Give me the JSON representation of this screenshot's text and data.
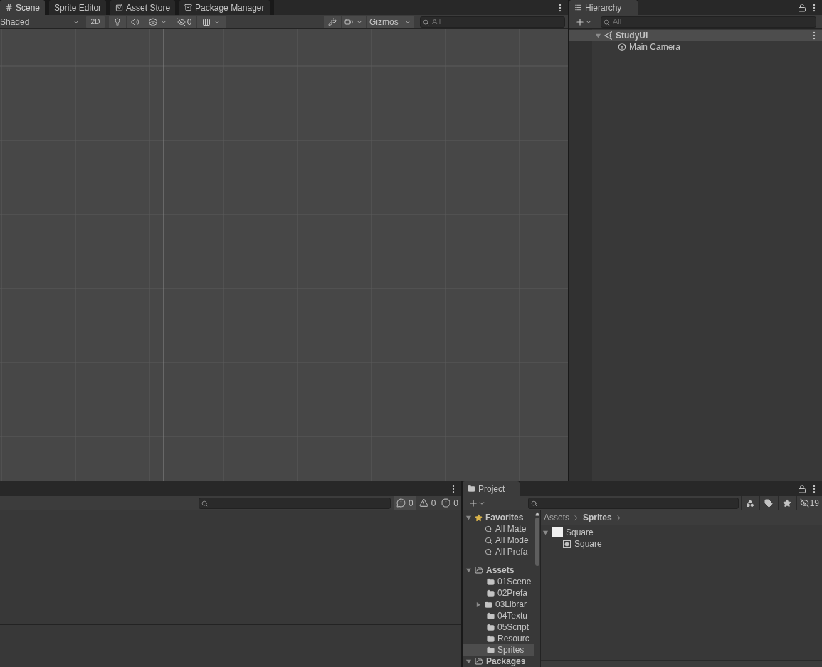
{
  "scene": {
    "tabs": [
      {
        "label": "Scene",
        "selected": true
      },
      {
        "label": "Sprite Editor",
        "selected": false
      },
      {
        "label": "Asset Store",
        "selected": false
      },
      {
        "label": "Package Manager",
        "selected": false
      }
    ],
    "draw_mode": "Shaded",
    "mode_2d": {
      "label": "2D",
      "on": false
    },
    "hidden_count": "0",
    "gizmos": "Gizmos",
    "search": {
      "placeholder": "All"
    }
  },
  "hierarchy": {
    "tab": "Hierarchy",
    "search": {
      "placeholder": "All"
    },
    "tree": [
      {
        "name": "StudyUI",
        "expanded": true,
        "selected": true,
        "children": [
          {
            "name": "Main Camera",
            "selected": false
          }
        ]
      }
    ]
  },
  "console": {
    "counts": [
      {
        "kind": "info",
        "count": "0"
      },
      {
        "kind": "warning",
        "count": "0"
      },
      {
        "kind": "error",
        "count": "0"
      }
    ]
  },
  "project": {
    "tab": "Project",
    "hidden_count": "19",
    "favorites": {
      "label": "Favorites",
      "expanded": true,
      "items": [
        "All Mate",
        "All Mode",
        "All Prefa"
      ]
    },
    "assets": {
      "label": "Assets",
      "expanded": true,
      "children": [
        {
          "name": "01Scene",
          "has_children": false,
          "selected": false
        },
        {
          "name": "02Prefa",
          "has_children": false,
          "selected": false
        },
        {
          "name": "03Librar",
          "has_children": true,
          "selected": false
        },
        {
          "name": "04Textu",
          "has_children": false,
          "selected": false
        },
        {
          "name": "05Script",
          "has_children": false,
          "selected": false
        },
        {
          "name": "Resourc",
          "has_children": false,
          "selected": false
        },
        {
          "name": "Sprites",
          "has_children": false,
          "selected": true
        }
      ]
    },
    "packages": {
      "label": "Packages",
      "expanded": true
    },
    "breadcrumb": [
      "Assets",
      "Sprites"
    ],
    "files": [
      {
        "name": "Square",
        "kind": "texture",
        "expanded": true,
        "children": [
          {
            "name": "Square",
            "kind": "sprite"
          }
        ]
      }
    ]
  }
}
